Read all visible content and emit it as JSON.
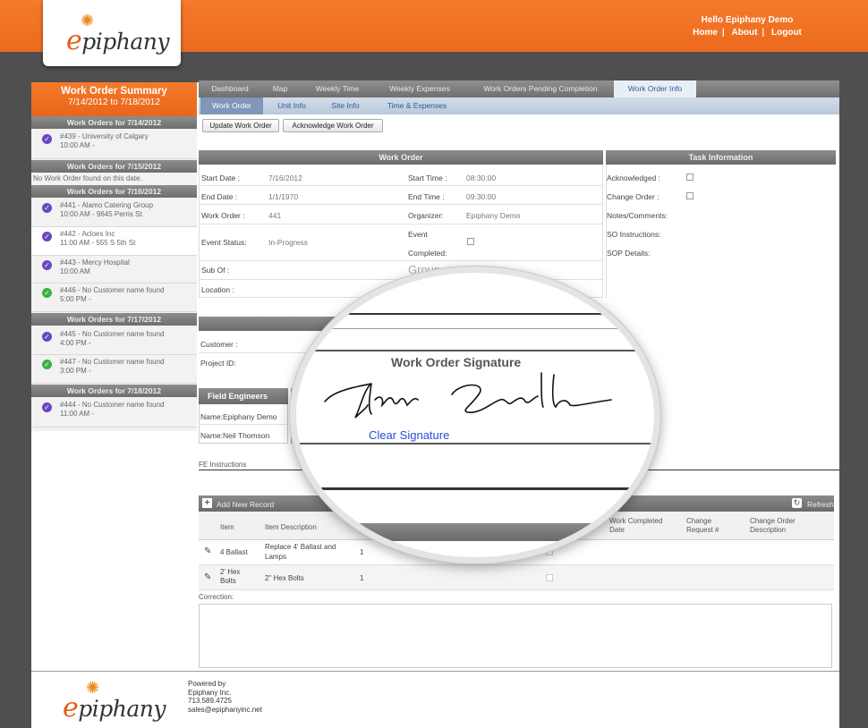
{
  "header": {
    "logo_text": "epiphany",
    "greeting": "Hello Epiphany Demo",
    "links": [
      "Home",
      "About",
      "Logout"
    ]
  },
  "sidebar": {
    "title": "Work Order Summary",
    "range": "7/14/2012 to 7/18/2012",
    "groups": [
      {
        "date": "Work Orders for 7/14/2012",
        "items": [
          {
            "line1": "#439 - University of Calgary",
            "line2": "10:00 AM -",
            "status": "purple"
          }
        ]
      },
      {
        "date": "Work Orders for 7/15/2012",
        "empty": "No Work Order found on this date.",
        "items": []
      },
      {
        "date": "Work Orders for 7/16/2012",
        "items": [
          {
            "line1": "#441 - Alamo Catering Group",
            "line2": "10:00 AM - 9645 Perris St.",
            "status": "purple"
          },
          {
            "line1": "#442 - Acloes Inc",
            "line2": "11:00 AM - 555 S 5th St",
            "status": "purple"
          },
          {
            "line1": "#443 - Mercy Hospital",
            "line2": "10:00 AM",
            "status": "purple"
          },
          {
            "line1": "#446 - No Customer name found",
            "line2": "5:00 PM -",
            "status": "green"
          }
        ]
      },
      {
        "date": "Work Orders for 7/17/2012",
        "items": [
          {
            "line1": "#445 - No Customer name found",
            "line2": "4:00 PM -",
            "status": "purple"
          },
          {
            "line1": "#447 - No Customer name found",
            "line2": "3:00 PM -",
            "status": "green"
          }
        ]
      },
      {
        "date": "Work Orders for 7/18/2012",
        "items": [
          {
            "line1": "#444 - No Customer name found",
            "line2": "11:00 AM -",
            "status": "purple"
          }
        ]
      }
    ]
  },
  "tabs": [
    "Dashboard",
    "Map",
    "Weekly Time",
    "Weekly Expenses",
    "Work Orders Pending Completion",
    "Work Order Info"
  ],
  "active_tab": "Work Order Info",
  "subtabs": [
    "Work Order",
    "Unit Info",
    "Site Info",
    "Time & Expenses"
  ],
  "active_subtab": "Work Order",
  "buttons": {
    "update": "Update Work Order",
    "acknowledge": "Acknowledge Work Order"
  },
  "work_order": {
    "title": "Work Order",
    "start_date_label": "Start Date :",
    "start_date": "7/16/2012",
    "end_date_label": "End Date :",
    "end_date": "1/1/1970",
    "work_order_label": "Work Order :",
    "work_order": "441",
    "event_status_label": "Event Status:",
    "event_status": "In-Progress",
    "sub_of_label": "Sub Of :",
    "location_label": "Location :",
    "start_time_label": "Start Time :",
    "start_time": "08:30:00",
    "end_time_label": "End Time :",
    "end_time": "09:30:00",
    "organizer_label": "Organizer:",
    "organizer": "Epiphany Demo",
    "event_completed_label_1": "Event",
    "event_completed_label_2": "Completed:",
    "group_peek": "Group"
  },
  "task_info": {
    "title": "Task Information",
    "acknowledged": "Acknowledged :",
    "change_order": "Change Order :",
    "notes": "Notes/Comments:",
    "so_instructions": "SO Instructions:",
    "sop_details": "SOP Details:"
  },
  "customer": {
    "customer_label": "Customer :",
    "project_label": "Project ID:"
  },
  "field_engineers": {
    "title": "Field Engineers",
    "rows": [
      "Name:Epiphany Demo",
      "Name:Neil Thomson"
    ]
  },
  "fe_instructions": "FE Instructions",
  "grid": {
    "add_label": "Add New Record",
    "refresh_label": "Refresh",
    "columns": [
      "Item",
      "Item Description",
      "Work Completed Date",
      "Change Request #",
      "Change Order Description"
    ],
    "rows": [
      {
        "item": "4 Ballast",
        "desc_1": "Replace 4' Ballast and",
        "desc_2": "Lamps",
        "qty": "1"
      },
      {
        "item_1": "2' Hex",
        "item_2": "Bolts",
        "desc": "2\" Hex Bolts",
        "qty": "1"
      }
    ]
  },
  "correction_label": "Correction:",
  "magnifier": {
    "title": "Work Order Signature",
    "clear": "Clear Signature"
  },
  "footer": {
    "lines": [
      "Powered by",
      "Epiphany Inc.",
      "713.589.4725",
      "sales@epiphanyinc.net"
    ]
  }
}
